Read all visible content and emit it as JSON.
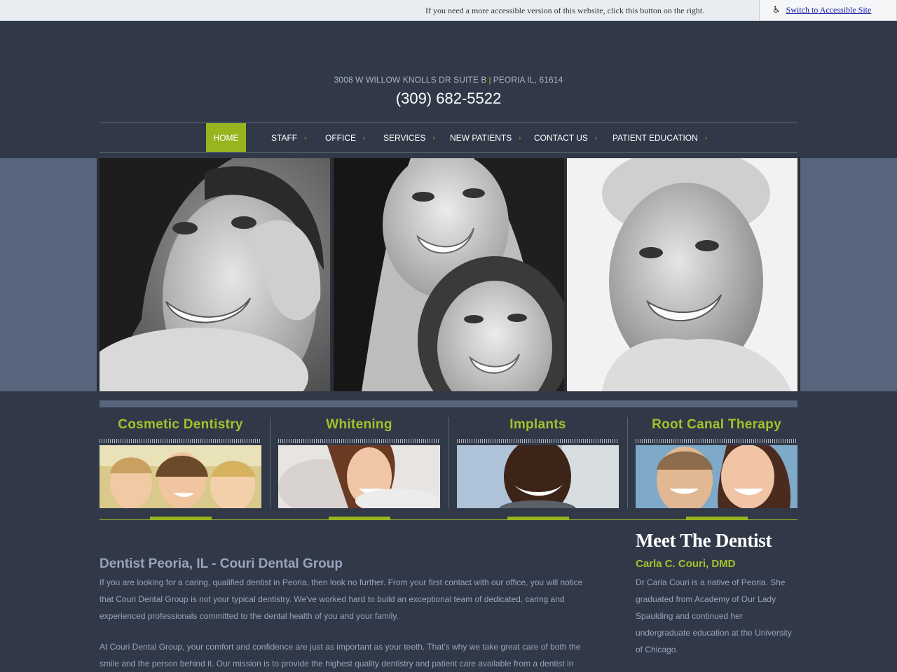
{
  "accessibility": {
    "message": "If you need a more accessible version of this website, click this button on the right.",
    "button_label": "Switch to Accessible Site",
    "icon": "wheelchair-icon"
  },
  "header": {
    "address_line": "3008 W WILLOW KNOLLS DR SUITE B",
    "city_line": "PEORIA IL, 61614",
    "phone": "(309) 682-5522"
  },
  "nav": {
    "items": [
      {
        "label": "HOME",
        "active": true
      },
      {
        "label": "STAFF"
      },
      {
        "label": "OFFICE"
      },
      {
        "label": "SERVICES"
      },
      {
        "label": "NEW PATIENTS"
      },
      {
        "label": "CONTACT US"
      },
      {
        "label": "PATIENT EDUCATION"
      }
    ],
    "chevron": "›"
  },
  "services": [
    {
      "title": "Cosmetic Dentistry"
    },
    {
      "title": "Whitening"
    },
    {
      "title": "Implants"
    },
    {
      "title": "Root Canal Therapy"
    }
  ],
  "main": {
    "title": "Dentist Peoria, IL - Couri Dental Group",
    "paragraphs": [
      "If you are looking for a caring, qualified dentist in Peoria, then look no further. From your first contact with our office, you will notice that Couri Dental Group is not your typical dentistry. We've worked hard to build an exceptional team of dedicated, caring and experienced professionals committed to the dental health of you and your family.",
      "At Couri Dental Group, your comfort and confidence are just as important as your teeth. That's why we take great care of both the smile and the person behind it. Our mission is to provide the highest quality dentistry and patient care available from a dentist in"
    ]
  },
  "sidebar": {
    "title": "Meet The Dentist",
    "name": "Carla C. Couri, DMD",
    "bio": "Dr Carla Couri is a native of Peoria. She graduated from Academy of Our Lady Spaulding and continued her undergraduate education at the University of Chicago."
  },
  "colors": {
    "background": "#313948",
    "accent": "#a6c12a",
    "nav_active": "#98b51f",
    "band": "#57657d",
    "text": "#97a5bd"
  }
}
